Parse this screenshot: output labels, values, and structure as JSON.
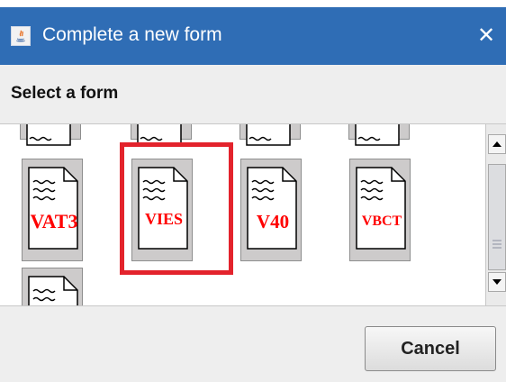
{
  "window": {
    "title": "Complete a new form",
    "app_icon": "java-icon",
    "close_glyph": "✕"
  },
  "header": {
    "title": "Select a form"
  },
  "forms": [
    {
      "label": "VAT3",
      "color": "#ff0000"
    },
    {
      "label": "VIES",
      "color": "#ff0000",
      "selected": true
    },
    {
      "label": "V40",
      "color": "#ff0000"
    },
    {
      "label": "VBCT",
      "color": "#ff0000"
    }
  ],
  "scrollbar": {
    "up_glyph": "▲",
    "down_glyph": "▼"
  },
  "footer": {
    "cancel_label": "Cancel"
  },
  "colors": {
    "titlebar": "#2f6db5",
    "selection_border": "#e3232c",
    "tile_bg": "#cdcbcb"
  }
}
